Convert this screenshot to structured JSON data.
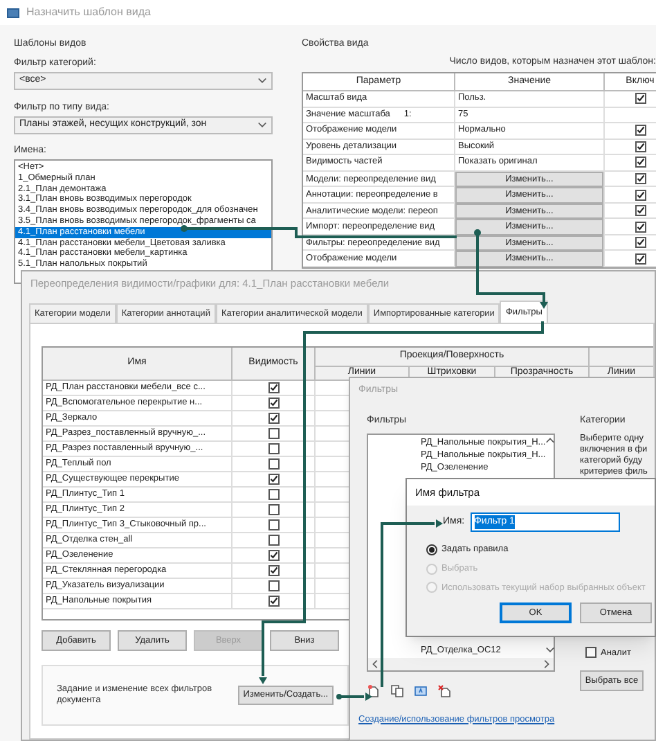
{
  "template_window": {
    "title": "Назначить шаблон вида",
    "templates": {
      "heading": "Шаблоны видов",
      "category_filter_label": "Фильтр категорий:",
      "category_filter_value": "<все>",
      "type_filter_label": "Фильтр по типу вида:",
      "type_filter_value": "Планы этажей, несущих конструкций, зон",
      "names_label": "Имена:",
      "names": [
        {
          "label": "<Нет>",
          "selected": false
        },
        {
          "label": "1_Обмерный план",
          "selected": false
        },
        {
          "label": "2.1_План демонтажа",
          "selected": false
        },
        {
          "label": "3.1_План вновь возводимых перегородок",
          "selected": false
        },
        {
          "label": "3.4_План вновь возводимых перегородок_для обозначен",
          "selected": false
        },
        {
          "label": "3.5_План вновь возводимых перегородок_фрагменты са",
          "selected": false
        },
        {
          "label": "4.1_План расстановки мебели",
          "selected": true
        },
        {
          "label": "4.1_План расстановки мебели_Цветовая заливка",
          "selected": false
        },
        {
          "label": "4.1_План расстановки мебели_картинка",
          "selected": false
        },
        {
          "label": "5.1_План напольных покрытий",
          "selected": false
        }
      ]
    },
    "properties": {
      "heading": "Свойства вида",
      "count_label": "Число видов, которым назначен этот шаблон:",
      "columns": [
        "Параметр",
        "Значение",
        "Включ"
      ],
      "rows": [
        {
          "parameter": "Масштаб вида",
          "kind": "text",
          "value": "Польз.",
          "included": true
        },
        {
          "parameter": "Значение масштаба",
          "suffix": "1:",
          "kind": "text",
          "value": "75"
        },
        {
          "parameter": "Отображение модели",
          "kind": "text",
          "value": "Нормально",
          "included": true
        },
        {
          "parameter": "Уровень детализации",
          "kind": "text",
          "value": "Высокий",
          "included": true
        },
        {
          "parameter": "Видимость частей",
          "kind": "text",
          "value": "Показать оригинал",
          "included": true
        },
        {
          "parameter": "Модели: переопределение вид",
          "kind": "button",
          "value": "Изменить...",
          "included": true
        },
        {
          "parameter": "Аннотации: переопределение в",
          "kind": "button",
          "value": "Изменить...",
          "included": true
        },
        {
          "parameter": "Аналитические модели: переоп",
          "kind": "button",
          "value": "Изменить...",
          "included": true
        },
        {
          "parameter": "Импорт: переопределение вид",
          "kind": "button",
          "value": "Изменить...",
          "included": true
        },
        {
          "parameter": "Фильтры: переопределение вид",
          "kind": "button",
          "value": "Изменить...",
          "included": true
        },
        {
          "parameter": "Отображение модели",
          "kind": "button",
          "value": "Изменить...",
          "included": true
        }
      ]
    }
  },
  "overrides_window": {
    "title": "Переопределения видимости/графики для: 4.1_План расстановки мебели",
    "tabs": [
      {
        "label": "Категории модели",
        "selected": false
      },
      {
        "label": "Категории аннотаций",
        "selected": false
      },
      {
        "label": "Категории аналитической модели",
        "selected": false
      },
      {
        "label": "Импортированные категории",
        "selected": false
      },
      {
        "label": "Фильтры",
        "selected": true
      }
    ],
    "table": {
      "columns": [
        "Имя",
        "Видимость"
      ],
      "group_header": "Проекция/Поверхность",
      "subcolumns": [
        "Линии",
        "Штриховки",
        "Прозрачность",
        "Линии"
      ],
      "rows": [
        {
          "name": "РД_План расстановки мебели_все с...",
          "visible": true
        },
        {
          "name": "РД_Вспомогательное перекрытие н...",
          "visible": true
        },
        {
          "name": "РД_Зеркало",
          "visible": true
        },
        {
          "name": "РД_Разрез_поставленный вручную_...",
          "visible": false
        },
        {
          "name": "РД_Разрез поставленный вручную_...",
          "visible": false
        },
        {
          "name": "РД_Теплый пол",
          "visible": false
        },
        {
          "name": "РД_Существующее перекрытие",
          "visible": true
        },
        {
          "name": "РД_Плинтус_Тип 1",
          "visible": false
        },
        {
          "name": "РД_Плинтус_Тип 2",
          "visible": false
        },
        {
          "name": "РД_Плинтус_Тип 3_Стыковочный пр...",
          "visible": false
        },
        {
          "name": "РД_Отделка стен_all",
          "visible": false
        },
        {
          "name": "РД_Озеленение",
          "visible": true
        },
        {
          "name": "РД_Стеклянная перегородка",
          "visible": true
        },
        {
          "name": "РД_Указатель визуализации",
          "visible": false
        },
        {
          "name": "РД_Напольные покрытия",
          "visible": true
        }
      ]
    },
    "buttons": [
      {
        "label": "Добавить",
        "disabled": false
      },
      {
        "label": "Удалить",
        "disabled": false
      },
      {
        "label": "Вверх",
        "disabled": true
      },
      {
        "label": "Вниз",
        "disabled": false
      }
    ],
    "document_filters": {
      "text": "Задание и изменение всех фильтров документа",
      "button": "Изменить/Создать..."
    }
  },
  "filters_window": {
    "title": "Фильтры",
    "filters_label": "Фильтры",
    "tree_items": [
      "РД_Напольные покрытия_Н...",
      "РД_Напольные покрытия_Н...",
      "РД_Озеленение"
    ],
    "last_item": "РД_Отделка_ОС12",
    "link": "Создание/использование фильтров просмотра",
    "categories_label": "Категории",
    "description_lines": [
      "Выберите одну",
      "включения в фи",
      "категорий буду",
      "критериев филь"
    ],
    "category_checkbox": {
      "label": "Аналит",
      "checked": false
    },
    "select_all": "Выбрать все"
  },
  "name_dialog": {
    "title": "Имя фильтра",
    "name_label": "Имя:",
    "name_value": "Фильтр 1",
    "options": [
      {
        "label": "Задать правила",
        "selected": true,
        "disabled": false
      },
      {
        "label": "Выбрать",
        "selected": false,
        "disabled": true
      },
      {
        "label": "Использовать текущий набор выбранных объект",
        "selected": false,
        "disabled": true
      }
    ],
    "buttons": [
      {
        "label": "OK",
        "default": true
      },
      {
        "label": "Отмена",
        "default": false
      }
    ]
  }
}
